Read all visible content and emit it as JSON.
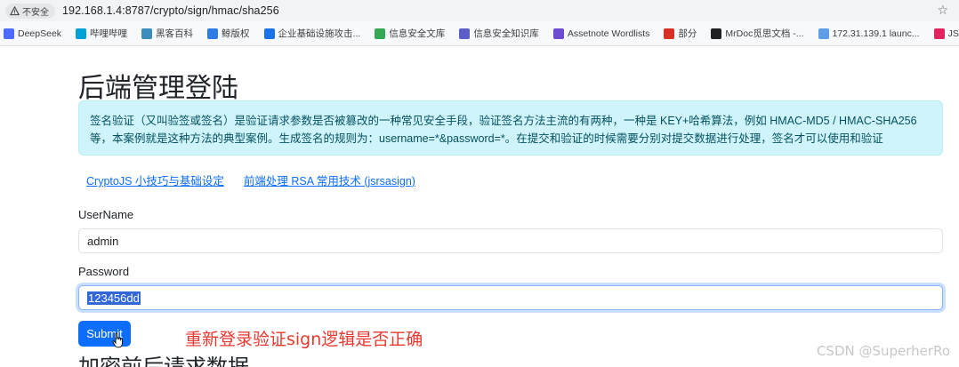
{
  "browser": {
    "insecure_label": "不安全",
    "url": "192.168.1.4:8787/crypto/sign/hmac/sha256",
    "bookmarks": [
      {
        "label": "DeepSeek",
        "icon": "deepseek-icon",
        "color": "#4d6bfe"
      },
      {
        "label": "哔哩哔哩",
        "icon": "bilibili-icon",
        "color": "#00a1d6"
      },
      {
        "label": "黑客百科",
        "icon": "hacker-wiki-icon",
        "color": "#3c8dbc"
      },
      {
        "label": "鲸版权",
        "icon": "whale-icon",
        "color": "#2d7be5"
      },
      {
        "label": "企业基础设施攻击...",
        "icon": "cube-icon",
        "color": "#1a73e8"
      },
      {
        "label": "信息安全文库",
        "icon": "shield-icon",
        "color": "#34a853"
      },
      {
        "label": "信息安全知识库",
        "icon": "diamond-icon",
        "color": "#5b5fc7"
      },
      {
        "label": "Assetnote Wordlists",
        "icon": "triangle-icon",
        "color": "#6c4bd1"
      },
      {
        "label": "部分",
        "icon": "shield-red-icon",
        "color": "#d93025"
      },
      {
        "label": "MrDoc觅思文档 -...",
        "icon": "mrdoc-icon",
        "color": "#202124"
      },
      {
        "label": "172.31.139.1 launc...",
        "icon": "network-icon",
        "color": "#5f9ee6"
      },
      {
        "label": "JS逆向靶场",
        "icon": "js-icon",
        "color": "#e0245e"
      }
    ]
  },
  "page": {
    "title": "后端管理登陆",
    "alert": "签名验证（又叫验签或签名）是验证请求参数是否被篡改的一种常见安全手段，验证签名方法主流的有两种，一种是 KEY+哈希算法，例如 HMAC-MD5 / HMAC-SHA256 等，本案例就是这种方法的典型案例。生成签名的规则为：username=*&password=*。在提交和验证的时候需要分别对提交数据进行处理，签名才可以使用和验证",
    "links": [
      "CryptoJS 小技巧与基础设定",
      "前端处理 RSA 常用技术 (jsrsasign)"
    ],
    "username_label": "UserName",
    "username_value": "admin",
    "password_label": "Password",
    "password_value": "123456dd",
    "submit_label": "Submit",
    "annotation": "重新登录验证sign逻辑是否正确",
    "next_heading": "加密前后请求数据"
  },
  "watermark": "CSDN @SuperherRo",
  "colors": {
    "accent": "#0d6efd",
    "alert_bg": "#cff4fc",
    "alert_text": "#055160",
    "annotation": "#e8382f"
  }
}
